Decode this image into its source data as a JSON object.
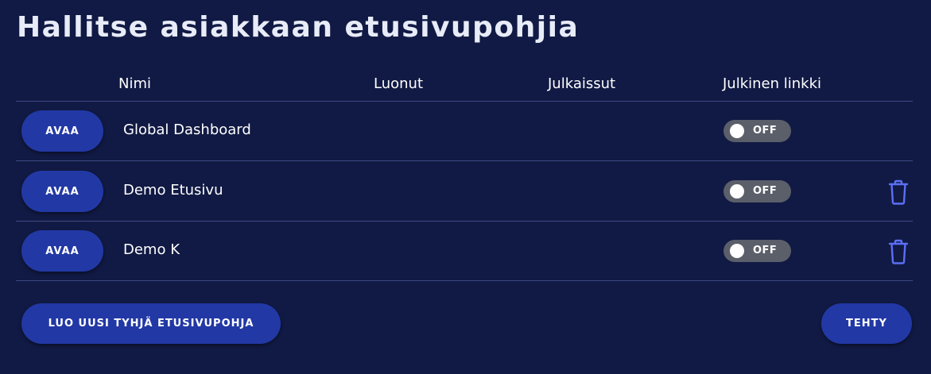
{
  "page": {
    "title": "Hallitse asiakkaan etusivupohjia"
  },
  "table": {
    "headers": {
      "name": "Nimi",
      "created": "Luonut",
      "published": "Julkaissut",
      "public_link": "Julkinen linkki"
    },
    "rows": [
      {
        "open_label": "AVAA",
        "name": "Global Dashboard",
        "toggle_label": "OFF",
        "deletable": false
      },
      {
        "open_label": "AVAA",
        "name": "Demo Etusivu",
        "toggle_label": "OFF",
        "deletable": true
      },
      {
        "open_label": "AVAA",
        "name": "Demo K",
        "toggle_label": "OFF",
        "deletable": true
      }
    ]
  },
  "footer": {
    "create_label": "LUO UUSI TYHJÄ ETUSIVUPOHJA",
    "done_label": "TEHTY"
  },
  "icons": {
    "delete": "trash-icon"
  },
  "colors": {
    "background": "#111a44",
    "button": "#2238a5",
    "toggle_off": "#5b5f6a",
    "trash": "#5b6ff5",
    "divider": "#3d4a82"
  }
}
